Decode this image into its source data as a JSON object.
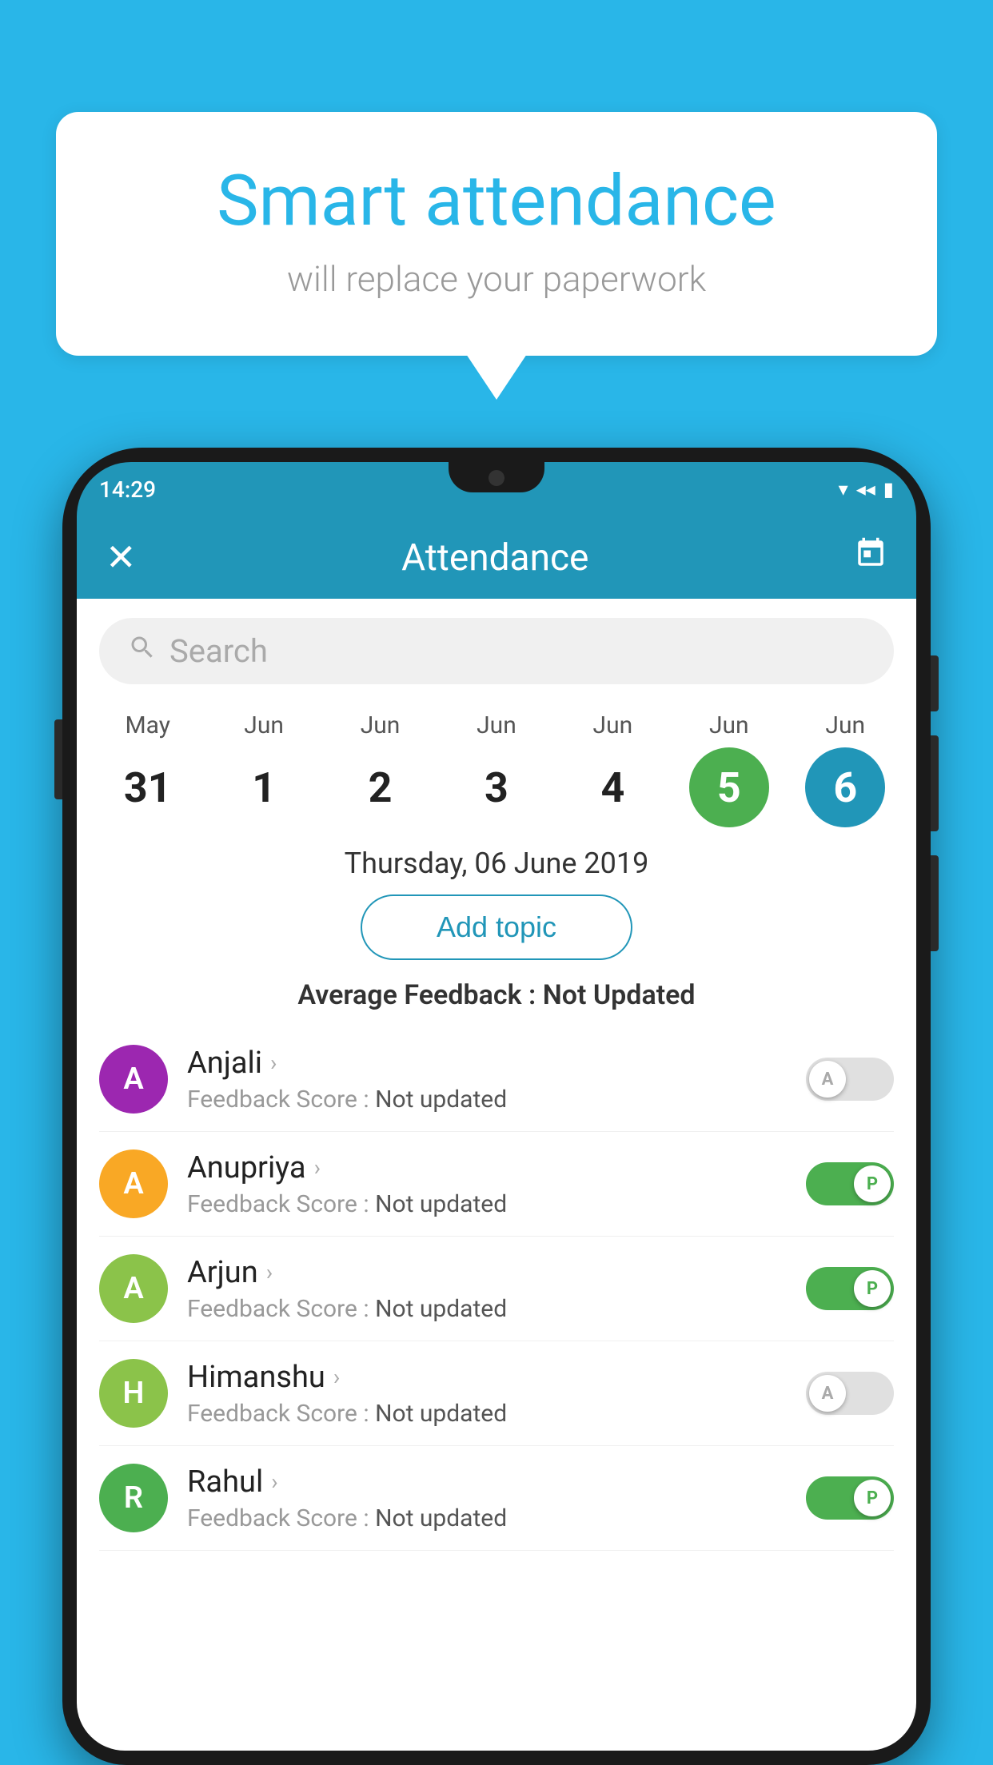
{
  "bubble": {
    "title": "Smart attendance",
    "subtitle": "will replace your paperwork"
  },
  "status_bar": {
    "time": "14:29",
    "wifi_icon": "▼",
    "signal_icon": "▲",
    "battery_icon": "▮"
  },
  "header": {
    "close_label": "✕",
    "title": "Attendance",
    "calendar_icon": "📅"
  },
  "search": {
    "placeholder": "Search"
  },
  "calendar": {
    "days": [
      {
        "month": "May",
        "num": "31",
        "state": "normal"
      },
      {
        "month": "Jun",
        "num": "1",
        "state": "normal"
      },
      {
        "month": "Jun",
        "num": "2",
        "state": "normal"
      },
      {
        "month": "Jun",
        "num": "3",
        "state": "normal"
      },
      {
        "month": "Jun",
        "num": "4",
        "state": "normal"
      },
      {
        "month": "Jun",
        "num": "5",
        "state": "today"
      },
      {
        "month": "Jun",
        "num": "6",
        "state": "selected"
      }
    ]
  },
  "selected_date": "Thursday, 06 June 2019",
  "add_topic_label": "Add topic",
  "avg_feedback_label": "Average Feedback :",
  "avg_feedback_value": "Not Updated",
  "students": [
    {
      "name": "Anjali",
      "avatar_letter": "A",
      "avatar_color": "#9c27b0",
      "feedback_label": "Feedback Score :",
      "feedback_value": "Not updated",
      "toggle_state": "off",
      "toggle_label": "A"
    },
    {
      "name": "Anupriya",
      "avatar_letter": "A",
      "avatar_color": "#f9a825",
      "feedback_label": "Feedback Score :",
      "feedback_value": "Not updated",
      "toggle_state": "on",
      "toggle_label": "P"
    },
    {
      "name": "Arjun",
      "avatar_letter": "A",
      "avatar_color": "#8bc34a",
      "feedback_label": "Feedback Score :",
      "feedback_value": "Not updated",
      "toggle_state": "on",
      "toggle_label": "P"
    },
    {
      "name": "Himanshu",
      "avatar_letter": "H",
      "avatar_color": "#8bc34a",
      "feedback_label": "Feedback Score :",
      "feedback_value": "Not updated",
      "toggle_state": "off",
      "toggle_label": "A"
    },
    {
      "name": "Rahul",
      "avatar_letter": "R",
      "avatar_color": "#4caf50",
      "feedback_label": "Feedback Score :",
      "feedback_value": "Not updated",
      "toggle_state": "on",
      "toggle_label": "P"
    }
  ]
}
